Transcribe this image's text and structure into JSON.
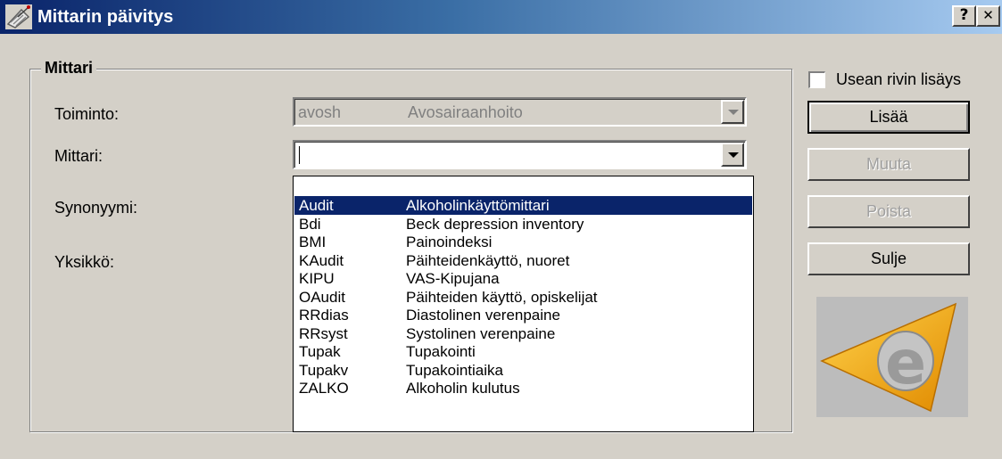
{
  "window": {
    "title": "Mittarin päivitys",
    "help_label": "?",
    "close_label": "✕",
    "icon": "satellite-dish-icon"
  },
  "group": {
    "legend": "Mittari",
    "fields": {
      "toiminto_label": "Toiminto:",
      "mittari_label": "Mittari:",
      "synonyymi_label": "Synonyymi:",
      "yksikko_label": "Yksikkö:"
    },
    "toiminto": {
      "code": "avosh",
      "name": "Avosairaanhoito",
      "enabled": false
    },
    "mittari": {
      "value": ""
    }
  },
  "dropdown": {
    "selected_index": 0,
    "items": [
      {
        "code": "Audit",
        "name": "Alkoholinkäyttömittari"
      },
      {
        "code": "Bdi",
        "name": "Beck depression inventory"
      },
      {
        "code": "BMI",
        "name": "Painoindeksi"
      },
      {
        "code": "KAudit",
        "name": "Päihteidenkäyttö, nuoret"
      },
      {
        "code": "KIPU",
        "name": "VAS-Kipujana"
      },
      {
        "code": "OAudit",
        "name": "Päihteiden käyttö, opiskelijat"
      },
      {
        "code": "RRdias",
        "name": "Diastolinen verenpaine"
      },
      {
        "code": "RRsyst",
        "name": "Systolinen verenpaine"
      },
      {
        "code": "Tupak",
        "name": "Tupakointi"
      },
      {
        "code": "Tupakv",
        "name": "Tupakointiaika"
      },
      {
        "code": "ZALKO",
        "name": "Alkoholin kulutus"
      }
    ]
  },
  "sidebar": {
    "multi_row_label": "Usean rivin lisäys",
    "multi_row_checked": false,
    "buttons": {
      "add": "Lisää",
      "edit": "Muuta",
      "delete": "Poista",
      "close": "Sulje"
    }
  },
  "colors": {
    "selection": "#0a246a",
    "logo_orange": "#f5a800",
    "dialog_face": "#d4d0c8"
  }
}
